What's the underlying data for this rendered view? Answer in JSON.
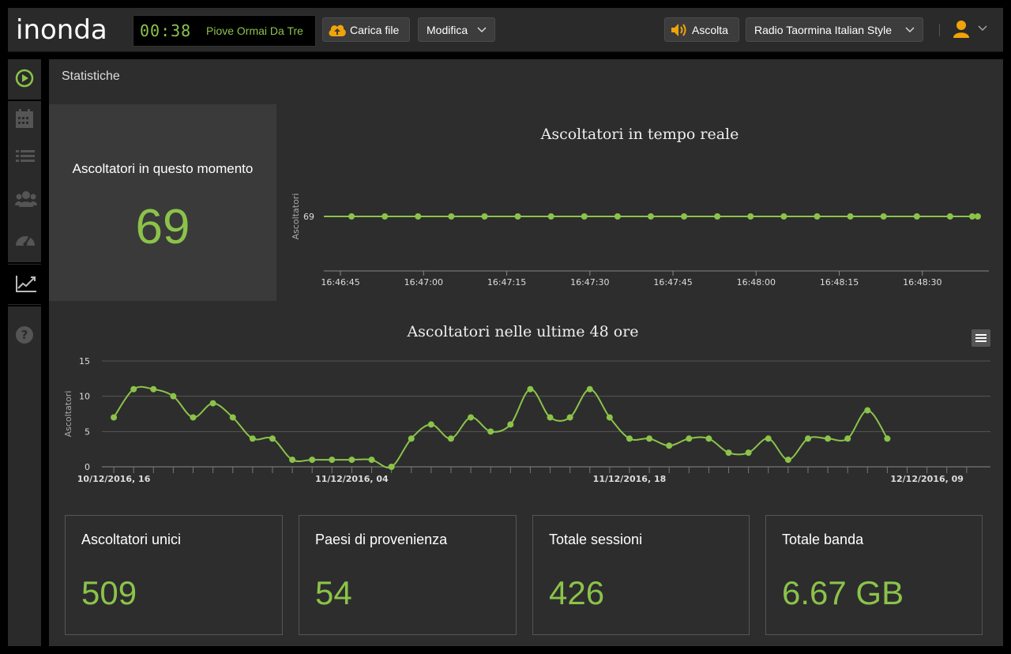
{
  "app": {
    "logo_text": "inonda"
  },
  "player": {
    "time": "00:38",
    "track": "Piove Ormai Da Tre"
  },
  "toolbar": {
    "upload_label": "Carica file",
    "modify_label": "Modifica",
    "listen_label": "Ascolta",
    "station_label": "Radio Taormina Italian Style"
  },
  "sidebar": {
    "items": [
      {
        "icon": "play-circle-icon"
      },
      {
        "icon": "calendar-icon"
      },
      {
        "icon": "list-icon"
      },
      {
        "icon": "users-icon"
      },
      {
        "icon": "gauge-icon"
      },
      {
        "icon": "line-chart-icon"
      },
      {
        "icon": "help-icon"
      }
    ]
  },
  "page": {
    "title": "Statistiche"
  },
  "live": {
    "label": "Ascoltatori in questo momento",
    "value": "69"
  },
  "colors": {
    "accent": "#8bc34a",
    "upload": "#f0a30a",
    "background": "#2d2d2d"
  },
  "chart_data": [
    {
      "type": "line",
      "title": "Ascoltatori in tempo reale",
      "ylabel": "Ascoltatori",
      "xlabel": "",
      "x_tick_labels": [
        "16:46:45",
        "16:47:00",
        "16:47:15",
        "16:47:30",
        "16:47:45",
        "16:48:00",
        "16:48:15",
        "16:48:30"
      ],
      "x_range_seconds": [
        -3,
        117
      ],
      "x": [
        2,
        8,
        14,
        20,
        26,
        32,
        38,
        44,
        50,
        56,
        62,
        68,
        74,
        80,
        86,
        92,
        98,
        104,
        110,
        114,
        115
      ],
      "y_tick_labels": [
        "69"
      ],
      "values": [
        69,
        69,
        69,
        69,
        69,
        69,
        69,
        69,
        69,
        69,
        69,
        69,
        69,
        69,
        69,
        69,
        69,
        69,
        69,
        69,
        69
      ]
    },
    {
      "type": "line",
      "title": "Ascoltatori nelle ultime 48 ore",
      "ylabel": "Ascoltatori",
      "xlabel": "",
      "ylim": [
        0,
        15
      ],
      "y_ticks": [
        0,
        5,
        10,
        15
      ],
      "x_tick_labels": [
        "10/12/2016, 16",
        "11/12/2016, 04",
        "11/12/2016, 18",
        "12/12/2016, 09"
      ],
      "x_tick_hours": [
        0,
        12,
        26,
        41
      ],
      "x_range_hours": [
        -0.6,
        44.2
      ],
      "x_hours": [
        0,
        1,
        2,
        3,
        4,
        5,
        6,
        7,
        8,
        9,
        10,
        11,
        12,
        13,
        14,
        15,
        16,
        17,
        18,
        19,
        20,
        21,
        22,
        23,
        24,
        25,
        26,
        27,
        28,
        29,
        30,
        31,
        32,
        33,
        34,
        35,
        36,
        37,
        38,
        39,
        40,
        41,
        42,
        43
      ],
      "values": [
        7,
        11,
        11,
        10,
        7,
        9,
        7,
        4,
        4,
        1,
        1,
        1,
        1,
        1,
        0,
        4,
        6,
        4,
        7,
        5,
        6,
        11,
        7,
        7,
        11,
        7,
        4,
        4,
        3,
        4,
        4,
        2,
        2,
        4,
        1,
        4,
        4,
        4,
        8,
        4
      ],
      "grid": true
    }
  ],
  "cards": [
    {
      "label": "Ascoltatori unici",
      "value": "509"
    },
    {
      "label": "Paesi di provenienza",
      "value": "54"
    },
    {
      "label": "Totale sessioni",
      "value": "426"
    },
    {
      "label": "Totale banda",
      "value": "6.67 GB"
    }
  ]
}
